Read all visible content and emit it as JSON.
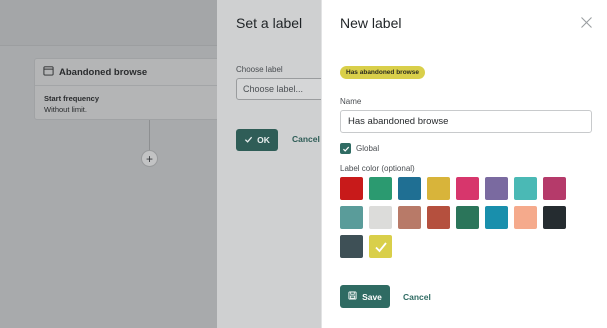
{
  "canvas": {
    "card": {
      "title": "Abandoned browse",
      "icon": "calendar-icon",
      "subtitle": "Start frequency",
      "value": "Without limit."
    },
    "add_node_icon": "plus-icon",
    "add_node_symbol": "+"
  },
  "set_label_panel": {
    "title": "Set a label",
    "choose_label": "Choose label",
    "select_placeholder": "Choose label...",
    "ok_label": "OK",
    "cancel_label": "Cancel"
  },
  "new_label_drawer": {
    "title": "New label",
    "close_icon": "close-icon",
    "preview_badge": "Has abandoned browse",
    "preview_color": "#d9cf4a",
    "name_label": "Name",
    "name_value": "Has abandoned browse",
    "global_label": "Global",
    "global_checked": true,
    "color_label": "Label color (optional)",
    "colors": [
      "#c81a1a",
      "#2b9a70",
      "#1f6f93",
      "#d8b43a",
      "#d7366c",
      "#7a6aa0",
      "#4ab9b5",
      "#b53a6a",
      "#5a9c9a",
      "#dcdcda",
      "#b87a68",
      "#b5503e",
      "#2b755a",
      "#198fac",
      "#f5aa8c",
      "#252c30",
      "#3e5056",
      "#d9cf4a"
    ],
    "selected_color_index": 17,
    "save_label": "Save",
    "cancel_label": "Cancel"
  }
}
